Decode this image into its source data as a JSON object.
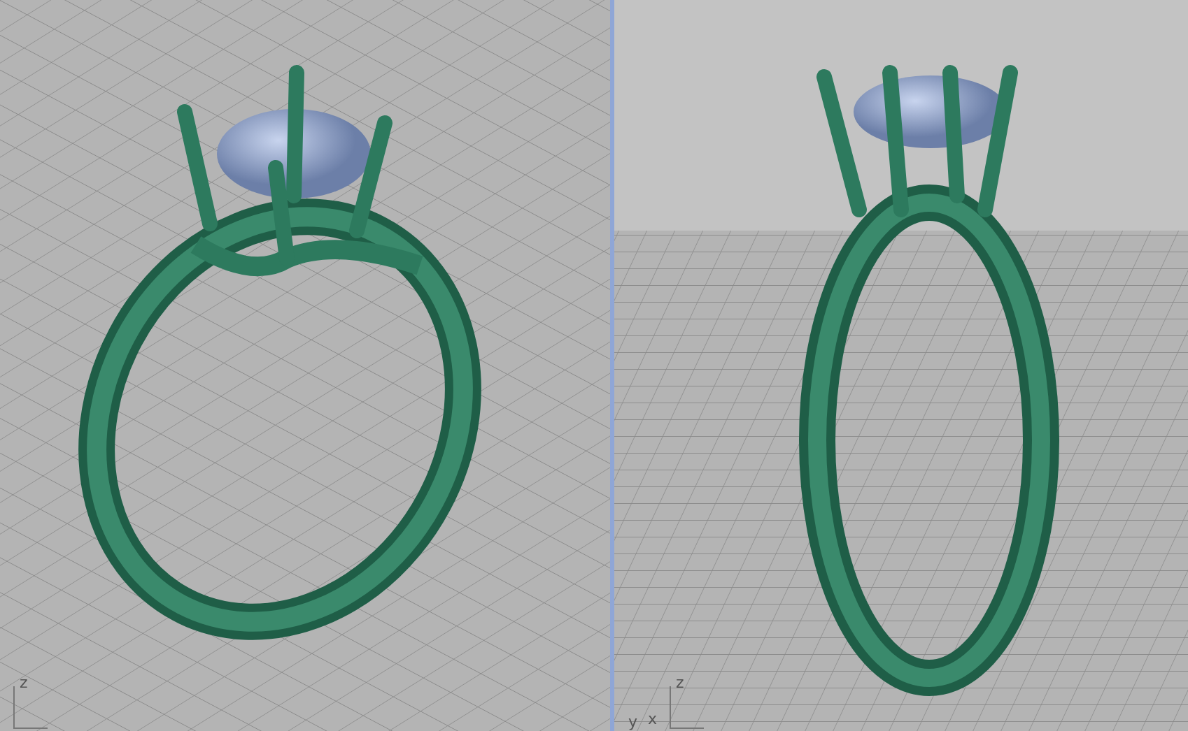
{
  "viewports": [
    {
      "kind": "angled",
      "axis_labels": [
        "z"
      ]
    },
    {
      "kind": "horizon",
      "axis_labels": [
        "z",
        "y",
        "x"
      ]
    }
  ]
}
